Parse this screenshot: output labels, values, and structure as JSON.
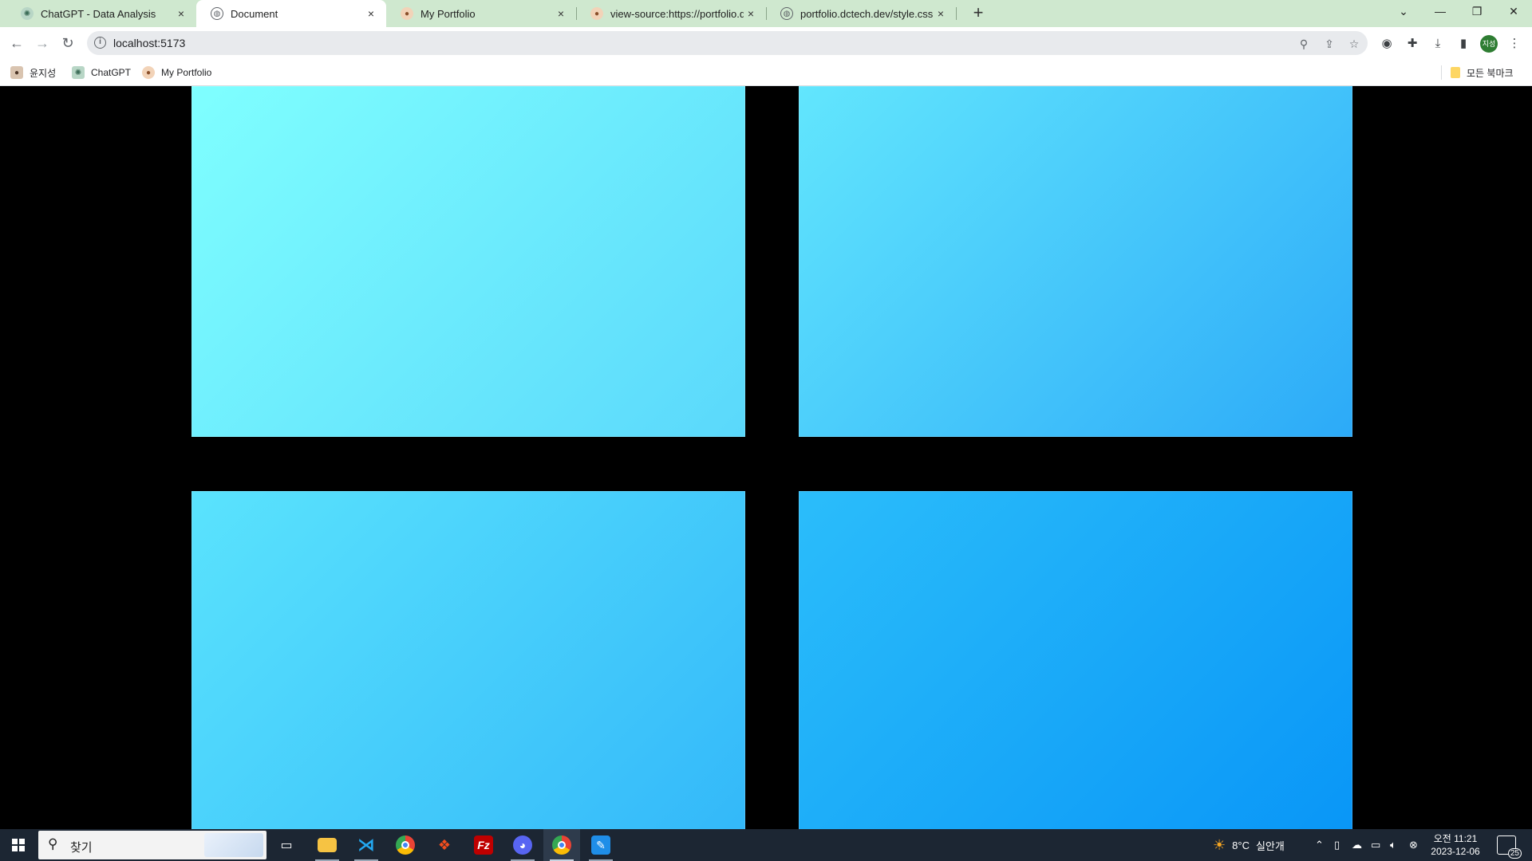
{
  "browser": {
    "tabs": [
      {
        "title": "ChatGPT - Data Analysis",
        "icon": "chatgpt-icon",
        "active": false
      },
      {
        "title": "Document",
        "icon": "globe-icon",
        "active": true
      },
      {
        "title": "My Portfolio",
        "icon": "portfolio-avatar-icon",
        "active": false
      },
      {
        "title": "view-source:https://portfolio.dc",
        "icon": "portfolio-avatar-icon",
        "active": false
      },
      {
        "title": "portfolio.dctech.dev/style.css",
        "icon": "globe-icon",
        "active": false
      }
    ],
    "close_glyph": "×",
    "new_tab_glyph": "+",
    "window_controls": {
      "list": "⌄",
      "minimize": "—",
      "restore": "❐",
      "close": "✕"
    },
    "address_bar": {
      "url": "localhost:5173",
      "info_glyph": "i"
    },
    "profile_initials": "지성",
    "bookmarks": [
      {
        "label": "윤지성",
        "icon": "person-avatar-icon"
      },
      {
        "label": "ChatGPT",
        "icon": "chatgpt-icon"
      },
      {
        "label": "My Portfolio",
        "icon": "portfolio-avatar-icon"
      }
    ],
    "all_bookmarks_label": "모든 북마크"
  },
  "page": {
    "background": "#000000",
    "tiles": [
      {
        "name": "tile-top-left",
        "gradient": [
          "#7fffff",
          "#5ad8fb"
        ]
      },
      {
        "name": "tile-top-right",
        "gradient": [
          "#62e6fd",
          "#2caaf8"
        ]
      },
      {
        "name": "tile-bottom-left",
        "gradient": [
          "#5ae3fd",
          "#33b8f9"
        ]
      },
      {
        "name": "tile-bottom-right",
        "gradient": [
          "#2bbdfa",
          "#0996f7"
        ]
      }
    ]
  },
  "taskbar": {
    "search_placeholder": "찾기",
    "apps": [
      "task-view-icon",
      "file-explorer-icon",
      "vscode-icon",
      "chrome-icon",
      "figma-icon",
      "filezilla-icon",
      "discord-icon",
      "chrome-profile-icon",
      "paint-icon"
    ],
    "weather": {
      "temp": "8°C",
      "label": "실안개"
    },
    "clock": {
      "time": "오전 11:21",
      "date": "2023-12-06"
    },
    "notification_count": "25"
  }
}
